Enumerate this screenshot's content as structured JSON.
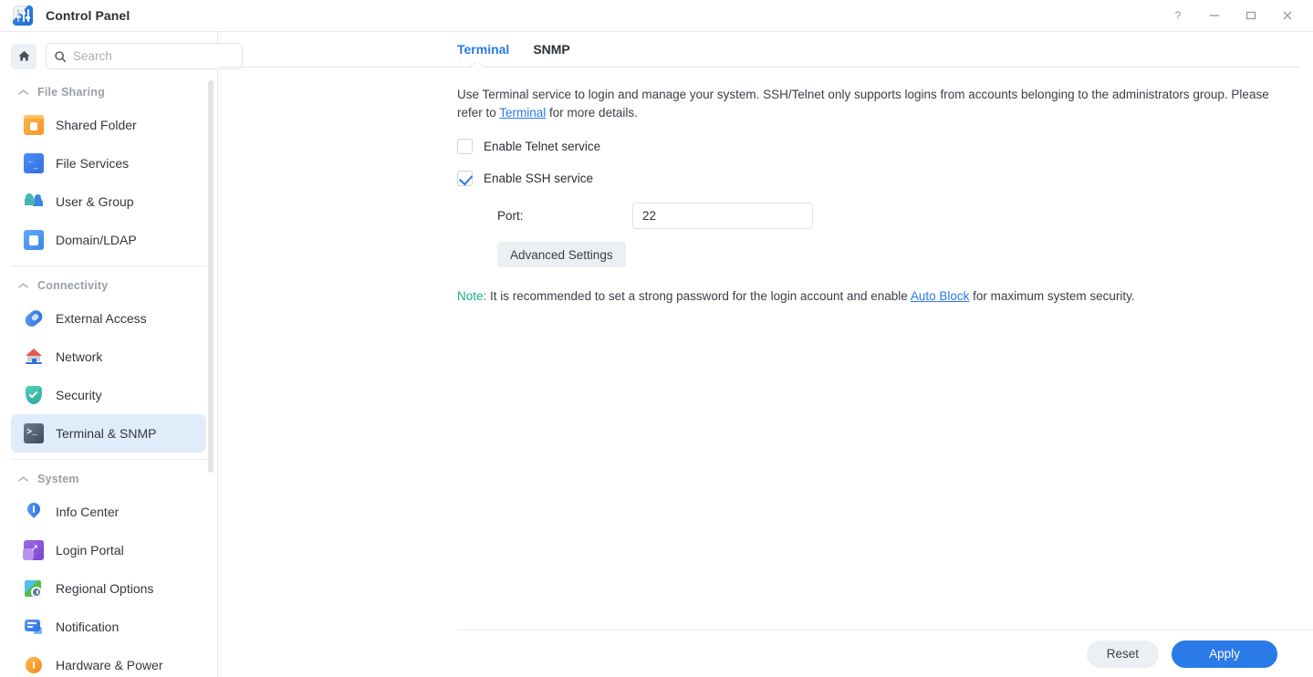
{
  "window": {
    "title": "Control Panel",
    "app_icon": "control-panel-icon",
    "controls": [
      {
        "name": "help-button",
        "glyph": "?"
      },
      {
        "name": "minimize-button",
        "glyph": "—"
      },
      {
        "name": "maximize-button",
        "glyph": "□"
      },
      {
        "name": "close-button",
        "glyph": "✕"
      }
    ]
  },
  "sidebar": {
    "home_icon": "home-icon",
    "search": {
      "placeholder": "Search",
      "value": "",
      "icon": "search-icon"
    },
    "sections": [
      {
        "label": "File Sharing",
        "collapse_icon": "chevron-up-icon",
        "items": [
          {
            "label": "Shared Folder",
            "icon": "shared-folder-icon",
            "active": false
          },
          {
            "label": "File Services",
            "icon": "file-services-icon",
            "active": false
          },
          {
            "label": "User & Group",
            "icon": "user-group-icon",
            "active": false
          },
          {
            "label": "Domain/LDAP",
            "icon": "domain-ldap-icon",
            "active": false
          }
        ]
      },
      {
        "label": "Connectivity",
        "collapse_icon": "chevron-up-icon",
        "items": [
          {
            "label": "External Access",
            "icon": "external-access-icon",
            "active": false
          },
          {
            "label": "Network",
            "icon": "network-icon",
            "active": false
          },
          {
            "label": "Security",
            "icon": "security-shield-icon",
            "active": false
          },
          {
            "label": "Terminal & SNMP",
            "icon": "terminal-icon",
            "active": true
          }
        ]
      },
      {
        "label": "System",
        "collapse_icon": "chevron-up-icon",
        "items": [
          {
            "label": "Info Center",
            "icon": "info-center-icon",
            "active": false
          },
          {
            "label": "Login Portal",
            "icon": "login-portal-icon",
            "active": false
          },
          {
            "label": "Regional Options",
            "icon": "regional-options-icon",
            "active": false
          },
          {
            "label": "Notification",
            "icon": "notification-icon",
            "active": false
          },
          {
            "label": "Hardware & Power",
            "icon": "hardware-power-icon",
            "active": false
          }
        ]
      }
    ]
  },
  "main": {
    "tabs": [
      {
        "label": "Terminal",
        "active": true
      },
      {
        "label": "SNMP",
        "active": false
      }
    ],
    "description": {
      "part1": "Use Terminal service to login and manage your system. SSH/Telnet only supports logins from accounts belonging to the administrators group. Please refer to ",
      "link": "Terminal",
      "part2": " for more details."
    },
    "telnet": {
      "label": "Enable Telnet service",
      "checked": false
    },
    "ssh": {
      "label": "Enable SSH service",
      "checked": true
    },
    "port": {
      "label": "Port:",
      "value": "22"
    },
    "advanced_settings_label": "Advanced Settings",
    "note": {
      "keyword": "Note:",
      "part1": " It is recommended to set a strong password for the login account and enable ",
      "link": "Auto Block",
      "part2": " for maximum system security."
    }
  },
  "footer": {
    "reset_label": "Reset",
    "apply_label": "Apply"
  },
  "colors": {
    "accent": "#2a79e8",
    "active_nav_bg": "#e1ecfb",
    "note_keyword": "#1aa98c",
    "primary_button": "#2a7ae8",
    "secondary_button": "#eceff3"
  }
}
